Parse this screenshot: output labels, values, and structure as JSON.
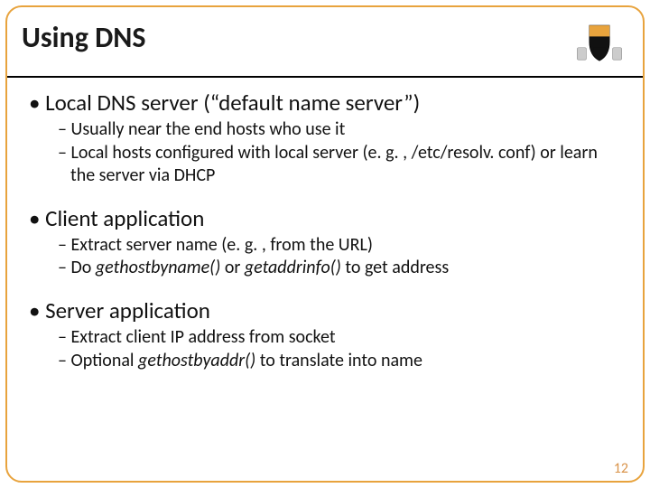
{
  "slide": {
    "title": "Using DNS",
    "page_number": "12"
  },
  "sections": [
    {
      "heading": "Local DNS server (“default name server”)",
      "items": [
        {
          "pre": "Usually near the end hosts who use it"
        },
        {
          "pre": "Local hosts configured with local server (e. g. , /etc/resolv. conf) or learn the server via DHCP"
        }
      ]
    },
    {
      "heading": "Client application",
      "items": [
        {
          "pre": "Extract server name (e. g. , from the URL)"
        },
        {
          "pre": "Do ",
          "ital": "gethostbyname()",
          "mid": " or ",
          "ital2": "getaddrinfo()",
          "post": " to get address"
        }
      ]
    },
    {
      "heading": "Server application",
      "items": [
        {
          "pre": "Extract client IP address from socket"
        },
        {
          "pre": "Optional ",
          "ital": "gethostbyaddr()",
          "post": " to translate into name"
        }
      ]
    }
  ]
}
